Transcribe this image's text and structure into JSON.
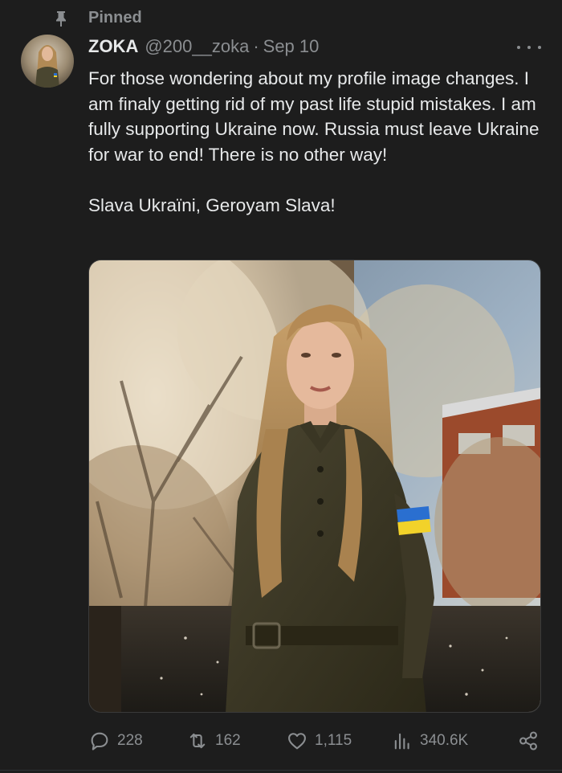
{
  "pinned": {
    "label": "Pinned",
    "icon": "pin-icon"
  },
  "author": {
    "display_name": "ZOKA",
    "handle": "@200__zoka",
    "separator": "·",
    "date": "Sep 10",
    "avatar": "avatar-image"
  },
  "tweet": {
    "paragraph_1": "For those wondering about my profile image changes. I am finaly getting rid of my past life stupid mistakes. I am fully supporting Ukraine now. Russia must leave Ukraine for war to end! There is no other way!",
    "paragraph_2": "Slava Ukraïni, Geroyam Slava!"
  },
  "media": {
    "alt": "Illustrated portrait of a long-haired woman in an olive military uniform with a Ukrainian flag patch, standing in front of blossoming trees and a brick building"
  },
  "actions": {
    "reply": {
      "icon": "reply-icon",
      "count": "228"
    },
    "repost": {
      "icon": "repost-icon",
      "count": "162"
    },
    "like": {
      "icon": "heart-icon",
      "count": "1,115"
    },
    "views": {
      "icon": "views-chart-icon",
      "count": "340.6K"
    },
    "share": {
      "icon": "share-icon"
    }
  },
  "colors": {
    "background": "#1d1d1d",
    "primary_text": "#e7e9ea",
    "secondary_text": "#8b8e91",
    "flag_blue": "#2a6fd0",
    "flag_yellow": "#f2d22a"
  }
}
